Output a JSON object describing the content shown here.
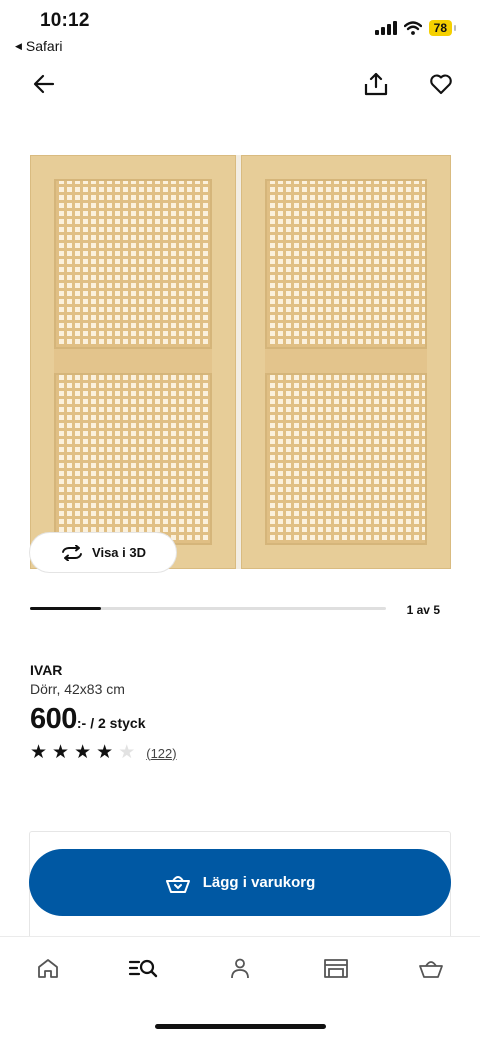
{
  "status_bar": {
    "time": "10:12",
    "back_app": "Safari",
    "battery": "78"
  },
  "top_nav": {
    "back_icon": "arrow-left-icon",
    "share_icon": "share-icon",
    "favorite_icon": "heart-icon"
  },
  "gallery": {
    "view_3d_label": "Visa i 3D",
    "view_3d_icon": "rotate-icon",
    "page_label": "1 av 5",
    "progress": 0.2
  },
  "product": {
    "brand": "IVAR",
    "description": "Dörr, 42x83 cm",
    "price": "600",
    "price_suffix": ":-",
    "unit": "/ 2 styck",
    "rating": 4,
    "max_rating": 5,
    "review_count": "(122)"
  },
  "cart": {
    "button_label": "Lägg i varukorg",
    "icon": "basket-icon"
  },
  "bottom_nav": {
    "items": [
      "home-icon",
      "search-icon",
      "profile-icon",
      "store-icon",
      "basket-icon"
    ]
  },
  "colors": {
    "primary_blue": "#0058a3",
    "battery_yellow": "#f5d000"
  }
}
